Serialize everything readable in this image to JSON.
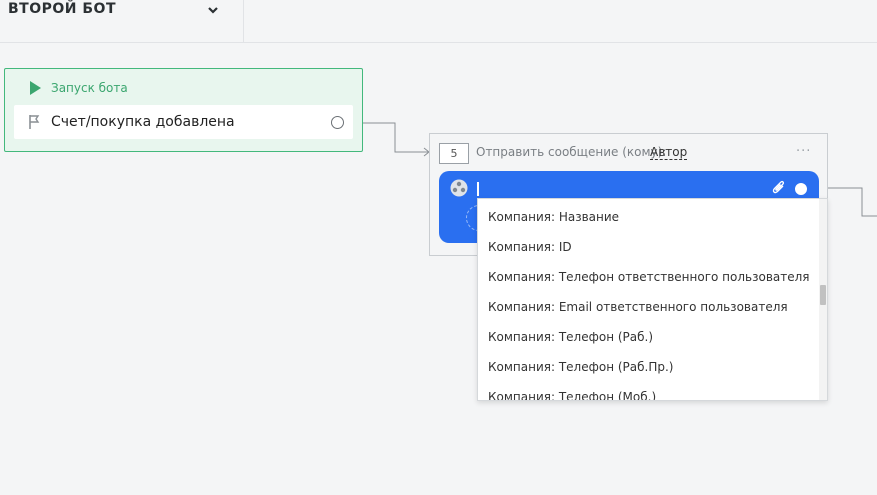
{
  "header": {
    "bot_title": "ВТОРОЙ БОТ",
    "chevron_icon": "chevron-down-icon"
  },
  "trigger": {
    "label": "Запуск бота",
    "event": "Счет/покупка добавлена",
    "color": "#3ba66f"
  },
  "action": {
    "step": "5",
    "label": "Отправить сообщение (кому):",
    "recipient": "Автор",
    "more": "···",
    "accent": "#2a6ff0"
  },
  "dropdown": {
    "items": [
      "Компания: Название",
      "Компания: ID",
      "Компания: Телефон ответственного пользователя",
      "Компания: Email ответственного пользователя",
      "Компания: Телефон (Раб.)",
      "Компания: Телефон (Раб.Пр.)",
      "Компания: Телефон (Моб.)"
    ]
  }
}
